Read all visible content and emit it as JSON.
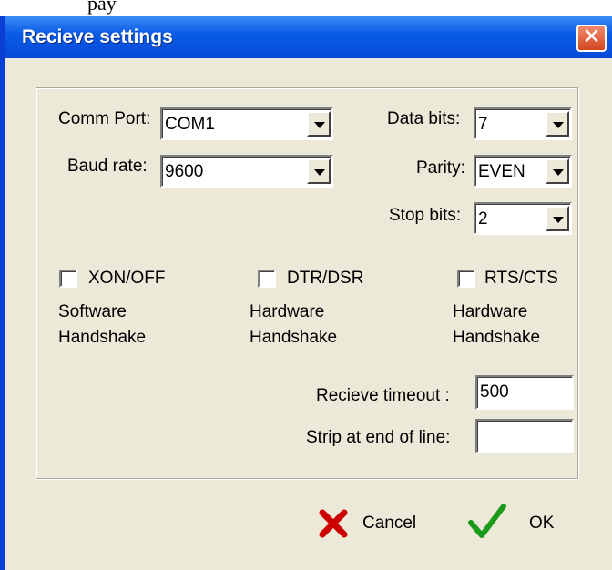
{
  "top_fragment": "pay",
  "dialog": {
    "title": "Recieve settings",
    "close_glyph": "✕"
  },
  "fields": {
    "comm_port": {
      "label": "Comm Port:",
      "value": "COM1"
    },
    "baud_rate": {
      "label": "Baud rate:",
      "value": "9600"
    },
    "data_bits": {
      "label": "Data bits:",
      "value": "7"
    },
    "parity": {
      "label": "Parity:",
      "value": "EVEN"
    },
    "stop_bits": {
      "label": "Stop bits:",
      "value": "2"
    }
  },
  "handshakes": {
    "xon_off": {
      "label": "XON/OFF",
      "checked": false,
      "line1": "Software",
      "line2": "Handshake"
    },
    "dtr_dsr": {
      "label": "DTR/DSR",
      "checked": false,
      "line1": "Hardware",
      "line2": "Handshake"
    },
    "rts_cts": {
      "label": "RTS/CTS",
      "checked": false,
      "line1": "Hardware",
      "line2": "Handshake"
    }
  },
  "timeout": {
    "label": "Recieve timeout :",
    "value": "500"
  },
  "strip": {
    "label": "Strip at end of line:",
    "value": ""
  },
  "buttons": {
    "cancel": {
      "label": "Cancel",
      "icon": "x-icon",
      "color": "#cc0000"
    },
    "ok": {
      "label": "OK",
      "icon": "checkmark-icon",
      "color": "#1a9a1a"
    }
  },
  "colors": {
    "titlebar": "#0a5ce6",
    "dialog_bg": "#ece9d8",
    "close": "#d3461f"
  }
}
